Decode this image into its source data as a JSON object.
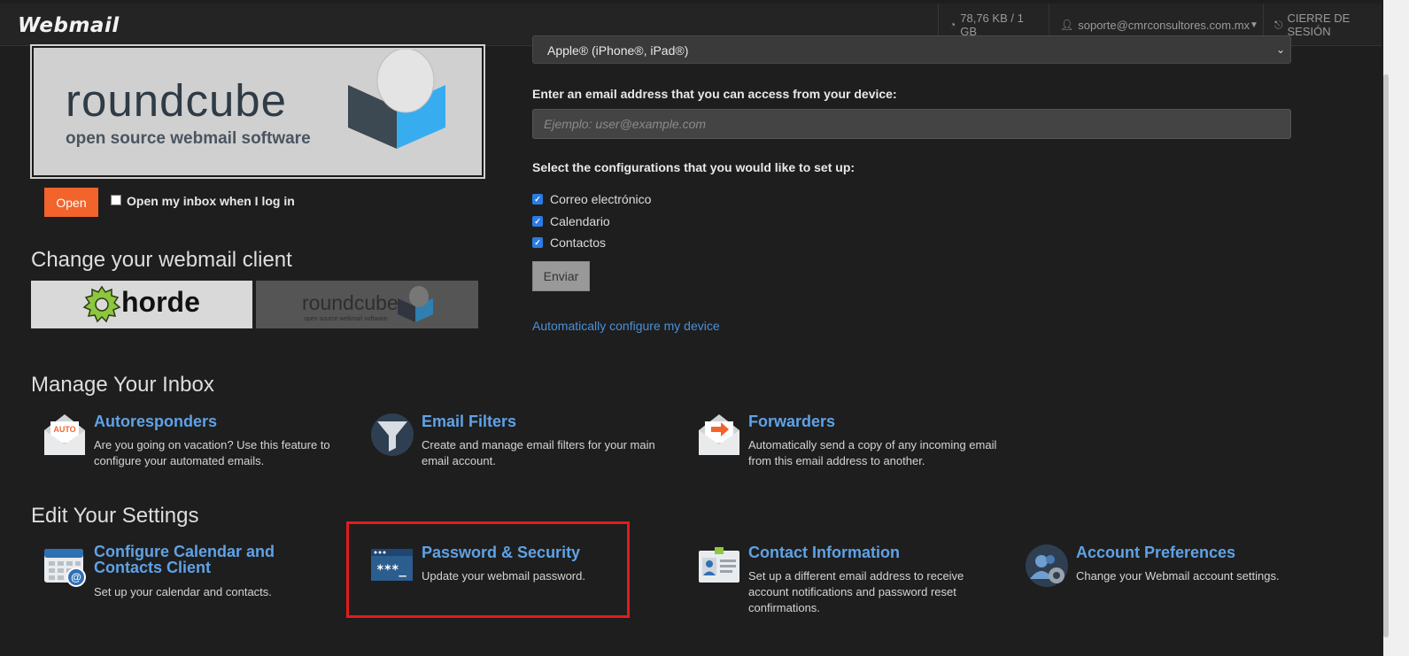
{
  "topbar": {
    "logo": "Webmail",
    "quota": "78,76 KB / 1 GB",
    "user": "soporte@cmrconsultores.com.mx",
    "logout": "CIERRE DE SESIÓN"
  },
  "roundcube_card": {
    "wordmark": "roundcube",
    "tagline": "open source webmail software"
  },
  "open_button": "Open",
  "open_inbox_label": "Open my inbox when I log in",
  "change_client": {
    "heading": "Change your webmail client",
    "horde_label": "horde",
    "roundcube_label": "roundcube",
    "roundcube_tagline": "open source webmail software"
  },
  "device_config": {
    "device_selected": "Apple® (iPhone®, iPad®)",
    "email_label": "Enter an email address that you can access from your device:",
    "email_placeholder": "Ejemplo: user@example.com",
    "configs_label": "Select the configurations that you would like to set up:",
    "options": [
      "Correo electrónico",
      "Calendario",
      "Contactos"
    ],
    "send_button": "Enviar",
    "auto_link": "Automatically configure my device"
  },
  "manage_inbox": {
    "heading": "Manage Your Inbox",
    "items": [
      {
        "title": "Autoresponders",
        "desc": "Are you going on vacation? Use this feature to configure your automated emails.",
        "icon": "auto-envelope-icon",
        "badge": "AUTO"
      },
      {
        "title": "Email Filters",
        "desc": "Create and manage email filters for your main email account.",
        "icon": "funnel-icon"
      },
      {
        "title": "Forwarders",
        "desc": "Automatically send a copy of any incoming email from this email address to another.",
        "icon": "forward-envelope-icon"
      }
    ]
  },
  "edit_settings": {
    "heading": "Edit Your Settings",
    "items": [
      {
        "title": "Configure Calendar and Contacts Client",
        "desc": "Set up your calendar and contacts.",
        "icon": "calendar-icon"
      },
      {
        "title": "Password & Security",
        "desc": "Update your webmail password.",
        "icon": "password-window-icon",
        "mask": "***_"
      },
      {
        "title": "Contact Information",
        "desc": "Set up a different email address to receive account notifications and password reset confirmations.",
        "icon": "contact-card-icon"
      },
      {
        "title": "Account Preferences",
        "desc": "Change your Webmail account settings.",
        "icon": "user-gear-icon"
      }
    ]
  },
  "colors": {
    "accent": "#5fa2e6",
    "open_button": "#f2642b",
    "highlight": "#e31b1b"
  }
}
